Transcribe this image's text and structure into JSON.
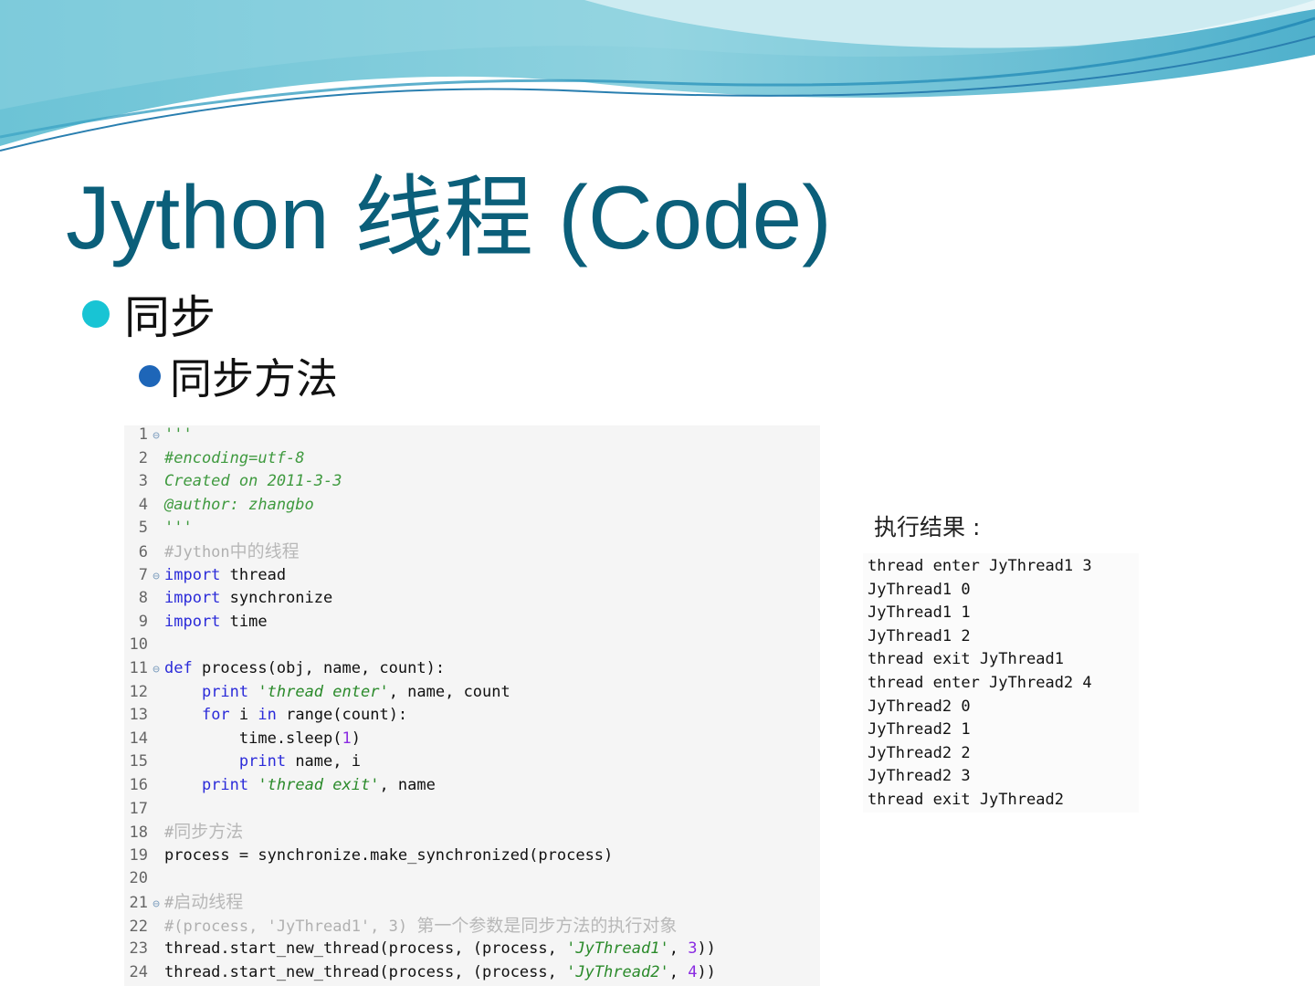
{
  "slide": {
    "title": "Jython 线程 (Code)",
    "bullet_1": "同步",
    "bullet_2": "同步方法",
    "colors": {
      "title": "#0b5f7a",
      "bullet_l1": "#18c4d4",
      "bullet_l2": "#1e66b8"
    }
  },
  "code": {
    "lines": [
      {
        "n": "1",
        "fold": true,
        "tokens": [
          {
            "t": "'''",
            "s": "com"
          }
        ]
      },
      {
        "n": "2",
        "fold": false,
        "tokens": [
          {
            "t": "#encoding=utf-8",
            "s": "com"
          }
        ]
      },
      {
        "n": "3",
        "fold": false,
        "tokens": [
          {
            "t": "Created on 2011-3-3",
            "s": "com"
          }
        ]
      },
      {
        "n": "4",
        "fold": false,
        "tokens": [
          {
            "t": "@author: zhangbo",
            "s": "com"
          }
        ]
      },
      {
        "n": "5",
        "fold": false,
        "tokens": [
          {
            "t": "'''",
            "s": "com"
          }
        ]
      },
      {
        "n": "6",
        "fold": false,
        "tokens": [
          {
            "t": "#Jython",
            "s": "gray"
          },
          {
            "t": "中的线程",
            "s": "graycn"
          }
        ]
      },
      {
        "n": "7",
        "fold": true,
        "tokens": [
          {
            "t": "import",
            "s": "kw"
          },
          {
            "t": " thread",
            "s": "plain"
          }
        ]
      },
      {
        "n": "8",
        "fold": false,
        "tokens": [
          {
            "t": "import",
            "s": "kw"
          },
          {
            "t": " synchronize",
            "s": "plain"
          }
        ]
      },
      {
        "n": "9",
        "fold": false,
        "tokens": [
          {
            "t": "import",
            "s": "kw"
          },
          {
            "t": " time",
            "s": "plain"
          }
        ]
      },
      {
        "n": "10",
        "fold": false,
        "tokens": []
      },
      {
        "n": "11",
        "fold": true,
        "tokens": [
          {
            "t": "def",
            "s": "kw"
          },
          {
            "t": " process(obj, name, count):",
            "s": "plain"
          }
        ]
      },
      {
        "n": "12",
        "fold": false,
        "tokens": [
          {
            "t": "    ",
            "s": "plain"
          },
          {
            "t": "print",
            "s": "kw"
          },
          {
            "t": " ",
            "s": "plain"
          },
          {
            "t": "'thread enter'",
            "s": "str"
          },
          {
            "t": ", name, count",
            "s": "plain"
          }
        ]
      },
      {
        "n": "13",
        "fold": false,
        "tokens": [
          {
            "t": "    ",
            "s": "plain"
          },
          {
            "t": "for",
            "s": "kw"
          },
          {
            "t": " i ",
            "s": "plain"
          },
          {
            "t": "in",
            "s": "kw"
          },
          {
            "t": " range(count):",
            "s": "plain"
          }
        ]
      },
      {
        "n": "14",
        "fold": false,
        "tokens": [
          {
            "t": "        time.sleep(",
            "s": "plain"
          },
          {
            "t": "1",
            "s": "num"
          },
          {
            "t": ")",
            "s": "plain"
          }
        ]
      },
      {
        "n": "15",
        "fold": false,
        "tokens": [
          {
            "t": "        ",
            "s": "plain"
          },
          {
            "t": "print",
            "s": "kw"
          },
          {
            "t": " name, i",
            "s": "plain"
          }
        ]
      },
      {
        "n": "16",
        "fold": false,
        "tokens": [
          {
            "t": "    ",
            "s": "plain"
          },
          {
            "t": "print",
            "s": "kw"
          },
          {
            "t": " ",
            "s": "plain"
          },
          {
            "t": "'thread exit'",
            "s": "str"
          },
          {
            "t": ", name",
            "s": "plain"
          }
        ]
      },
      {
        "n": "17",
        "fold": false,
        "tokens": []
      },
      {
        "n": "18",
        "fold": false,
        "tokens": [
          {
            "t": "#",
            "s": "gray"
          },
          {
            "t": "同步方法",
            "s": "graycn"
          }
        ]
      },
      {
        "n": "19",
        "fold": false,
        "tokens": [
          {
            "t": "process = synchronize.make_synchronized(process)",
            "s": "plain"
          }
        ]
      },
      {
        "n": "20",
        "fold": false,
        "tokens": []
      },
      {
        "n": "21",
        "fold": true,
        "tokens": [
          {
            "t": "#",
            "s": "gray"
          },
          {
            "t": "启动线程",
            "s": "graycn"
          }
        ]
      },
      {
        "n": "22",
        "fold": false,
        "tokens": [
          {
            "t": "#(process, 'JyThread1', 3) ",
            "s": "gray"
          },
          {
            "t": "第一个参数是同步方法的执行对象",
            "s": "graycn"
          }
        ]
      },
      {
        "n": "23",
        "fold": false,
        "tokens": [
          {
            "t": "thread.start_new_thread(process, (process, ",
            "s": "plain"
          },
          {
            "t": "'JyThread1'",
            "s": "str"
          },
          {
            "t": ", ",
            "s": "plain"
          },
          {
            "t": "3",
            "s": "num"
          },
          {
            "t": "))",
            "s": "plain"
          }
        ]
      },
      {
        "n": "24",
        "fold": false,
        "tokens": [
          {
            "t": "thread.start_new_thread(process, (process, ",
            "s": "plain"
          },
          {
            "t": "'JyThread2'",
            "s": "str"
          },
          {
            "t": ", ",
            "s": "plain"
          },
          {
            "t": "4",
            "s": "num"
          },
          {
            "t": "))",
            "s": "plain"
          }
        ]
      }
    ]
  },
  "result": {
    "label": "执行结果 :",
    "lines": [
      "thread enter JyThread1 3",
      "JyThread1 0",
      "JyThread1 1",
      "JyThread1 2",
      "thread exit JyThread1",
      "thread enter JyThread2 4",
      "JyThread2 0",
      "JyThread2 1",
      "JyThread2 2",
      "JyThread2 3",
      "thread exit JyThread2"
    ]
  }
}
